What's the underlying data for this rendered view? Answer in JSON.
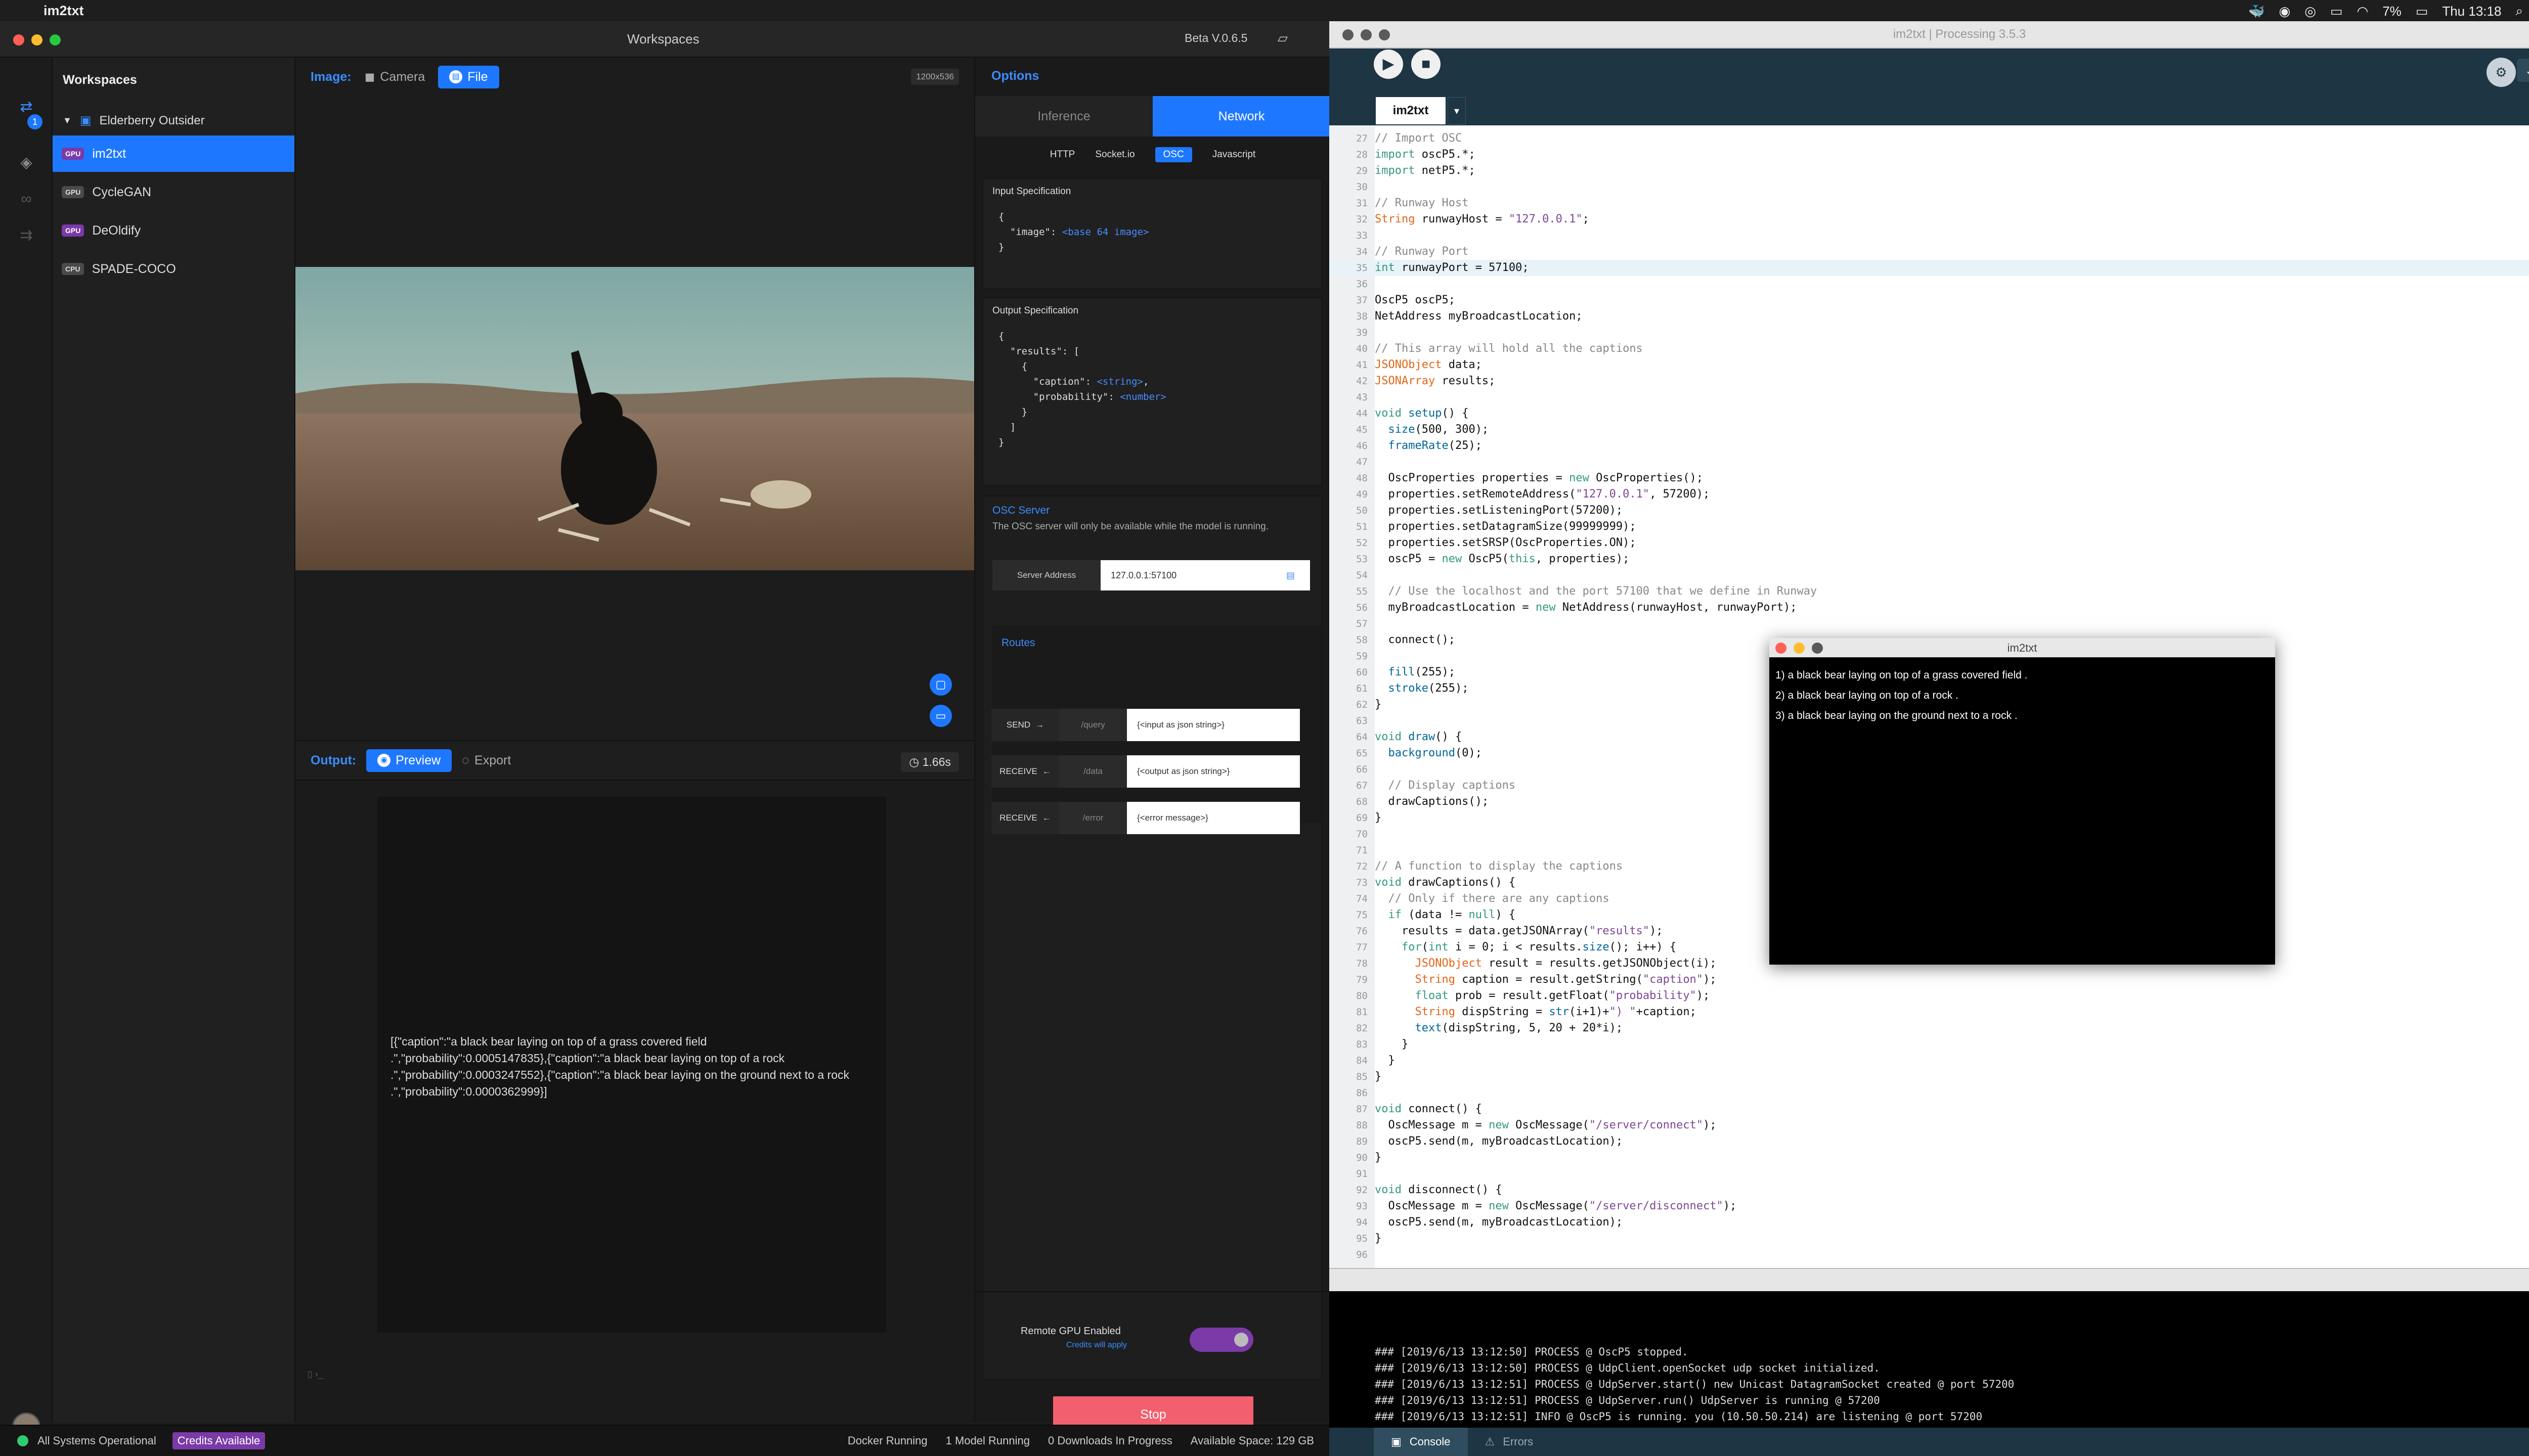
{
  "menubar": {
    "app_name": "im2txt",
    "battery": "7%",
    "clock": "Thu 13:18"
  },
  "runway": {
    "window_title": "Workspaces",
    "version": "Beta V.0.6.5",
    "rail_badge": "1",
    "sidebar": {
      "title": "Workspaces",
      "workspace": "Elderberry Outsider",
      "models": [
        {
          "label": "im2txt",
          "badge": "GPU"
        },
        {
          "label": "CycleGAN",
          "badge": "GPU"
        },
        {
          "label": "DeOldify",
          "badge": "GPU"
        },
        {
          "label": "SPADE-COCO",
          "badge": "CPU"
        }
      ]
    },
    "input": {
      "label": "Image:",
      "camera": "Camera",
      "file": "File",
      "resolution": "1200x536"
    },
    "output": {
      "label": "Output:",
      "preview": "Preview",
      "export": "Export",
      "time": "1.66s",
      "text": "[{\"caption\":\"a black bear laying on top of a grass covered field .\",\"probability\":0.0005147835},{\"caption\":\"a black bear laying on top of a rock .\",\"probability\":0.0003247552},{\"caption\":\"a black bear laying on the ground next to a rock .\",\"probability\":0.0000362999}]"
    },
    "options": {
      "title": "Options",
      "tabs": [
        "Inference",
        "Network"
      ],
      "subtabs": [
        "HTTP",
        "Socket.io",
        "OSC",
        "Javascript"
      ],
      "input_spec_title": "Input Specification",
      "input_spec_key": "\"image\"",
      "input_spec_val": "<base 64 image>",
      "output_spec_title": "Output Specification",
      "output_results_key": "\"results\"",
      "output_caption_key": "\"caption\"",
      "output_caption_val": "<string>",
      "output_prob_key": "\"probability\"",
      "output_prob_val": "<number>",
      "osc_title": "OSC Server",
      "osc_desc": "The OSC server will only be available while the model is running.",
      "server_label": "Server Address",
      "server_value": "127.0.0.1:57100",
      "routes_title": "Routes",
      "routes": [
        {
          "kind": "SEND",
          "path": "/query",
          "value": "{<input as json string>}"
        },
        {
          "kind": "RECEIVE",
          "path": "/data",
          "value": "{<output as json string>}"
        },
        {
          "kind": "RECEIVE",
          "path": "/error",
          "value": "{<error message>}"
        }
      ],
      "remote_gpu": "Remote GPU Enabled",
      "credits_note": "Credits will apply",
      "stop": "Stop"
    },
    "status": {
      "systems": "All Systems Operational",
      "credits": "Credits Available",
      "docker": "Docker Running",
      "models": "1 Model Running",
      "downloads": "0 Downloads In Progress",
      "space": "Available Space: 129 GB"
    }
  },
  "processing": {
    "window_title": "im2txt | Processing 3.5.3",
    "tab": "im2txt",
    "mode": "Java ▾",
    "code_lines": [
      {
        "n": 27,
        "t": "// Import OSC"
      },
      {
        "n": 28,
        "t": "import oscP5.*;"
      },
      {
        "n": 29,
        "t": "import netP5.*;"
      },
      {
        "n": 30,
        "t": ""
      },
      {
        "n": 31,
        "t": "// Runway Host"
      },
      {
        "n": 32,
        "t": "String runwayHost = \"127.0.0.1\";"
      },
      {
        "n": 33,
        "t": ""
      },
      {
        "n": 34,
        "t": "// Runway Port"
      },
      {
        "n": 35,
        "t": "int runwayPort = 57100;"
      },
      {
        "n": 36,
        "t": ""
      },
      {
        "n": 37,
        "t": "OscP5 oscP5;"
      },
      {
        "n": 38,
        "t": "NetAddress myBroadcastLocation;"
      },
      {
        "n": 39,
        "t": ""
      },
      {
        "n": 40,
        "t": "// This array will hold all the captions"
      },
      {
        "n": 41,
        "t": "JSONObject data;"
      },
      {
        "n": 42,
        "t": "JSONArray results;"
      },
      {
        "n": 43,
        "t": ""
      },
      {
        "n": 44,
        "t": "void setup() {"
      },
      {
        "n": 45,
        "t": "  size(500, 300);"
      },
      {
        "n": 46,
        "t": "  frameRate(25);"
      },
      {
        "n": 47,
        "t": ""
      },
      {
        "n": 48,
        "t": "  OscProperties properties = new OscProperties();"
      },
      {
        "n": 49,
        "t": "  properties.setRemoteAddress(\"127.0.0.1\", 57200);"
      },
      {
        "n": 50,
        "t": "  properties.setListeningPort(57200);"
      },
      {
        "n": 51,
        "t": "  properties.setDatagramSize(99999999);"
      },
      {
        "n": 52,
        "t": "  properties.setSRSP(OscProperties.ON);"
      },
      {
        "n": 53,
        "t": "  oscP5 = new OscP5(this, properties);"
      },
      {
        "n": 54,
        "t": ""
      },
      {
        "n": 55,
        "t": "  // Use the localhost and the port 57100 that we define in Runway"
      },
      {
        "n": 56,
        "t": "  myBroadcastLocation = new NetAddress(runwayHost, runwayPort);"
      },
      {
        "n": 57,
        "t": ""
      },
      {
        "n": 58,
        "t": "  connect();"
      },
      {
        "n": 59,
        "t": ""
      },
      {
        "n": 60,
        "t": "  fill(255);"
      },
      {
        "n": 61,
        "t": "  stroke(255);"
      },
      {
        "n": 62,
        "t": "}"
      },
      {
        "n": 63,
        "t": ""
      },
      {
        "n": 64,
        "t": "void draw() {"
      },
      {
        "n": 65,
        "t": "  background(0);"
      },
      {
        "n": 66,
        "t": ""
      },
      {
        "n": 67,
        "t": "  // Display captions"
      },
      {
        "n": 68,
        "t": "  drawCaptions();"
      },
      {
        "n": 69,
        "t": "}"
      },
      {
        "n": 70,
        "t": ""
      },
      {
        "n": 71,
        "t": ""
      },
      {
        "n": 72,
        "t": "// A function to display the captions"
      },
      {
        "n": 73,
        "t": "void drawCaptions() {"
      },
      {
        "n": 74,
        "t": "  // Only if there are any captions"
      },
      {
        "n": 75,
        "t": "  if (data != null) {"
      },
      {
        "n": 76,
        "t": "    results = data.getJSONArray(\"results\");"
      },
      {
        "n": 77,
        "t": "    for(int i = 0; i < results.size(); i++) {"
      },
      {
        "n": 78,
        "t": "      JSONObject result = results.getJSONObject(i);"
      },
      {
        "n": 79,
        "t": "      String caption = result.getString(\"caption\");"
      },
      {
        "n": 80,
        "t": "      float prob = result.getFloat(\"probability\");"
      },
      {
        "n": 81,
        "t": "      String dispString = str(i+1)+\") \"+caption;"
      },
      {
        "n": 82,
        "t": "      text(dispString, 5, 20 + 20*i);"
      },
      {
        "n": 83,
        "t": "    }"
      },
      {
        "n": 84,
        "t": "  }"
      },
      {
        "n": 85,
        "t": "}"
      },
      {
        "n": 86,
        "t": ""
      },
      {
        "n": 87,
        "t": "void connect() {"
      },
      {
        "n": 88,
        "t": "  OscMessage m = new OscMessage(\"/server/connect\");"
      },
      {
        "n": 89,
        "t": "  oscP5.send(m, myBroadcastLocation);"
      },
      {
        "n": 90,
        "t": "}"
      },
      {
        "n": 91,
        "t": ""
      },
      {
        "n": 92,
        "t": "void disconnect() {"
      },
      {
        "n": 93,
        "t": "  OscMessage m = new OscMessage(\"/server/disconnect\");"
      },
      {
        "n": 94,
        "t": "  oscP5.send(m, myBroadcastLocation);"
      },
      {
        "n": 95,
        "t": "}"
      },
      {
        "n": 96,
        "t": ""
      }
    ],
    "console_lines": [
      "### [2019/6/13 13:12:50] PROCESS @ OscP5 stopped.",
      "### [2019/6/13 13:12:50] PROCESS @ UdpClient.openSocket udp socket initialized.",
      "### [2019/6/13 13:12:51] PROCESS @ UdpServer.start() new Unicast DatagramSocket created @ port 57200",
      "### [2019/6/13 13:12:51] PROCESS @ UdpServer.run() UdpServer is running @ 57200",
      "### [2019/6/13 13:12:51] INFO @ OscP5 is running. you (10.50.50.214) are listening @ port 57200"
    ],
    "console_tabs": [
      "Console",
      "Errors"
    ]
  },
  "sketch": {
    "title": "im2txt",
    "captions": [
      "1) a black bear laying on top of a grass covered field .",
      "2) a black bear laying on top of a rock .",
      "3) a black bear laying on the ground next to a rock ."
    ]
  }
}
